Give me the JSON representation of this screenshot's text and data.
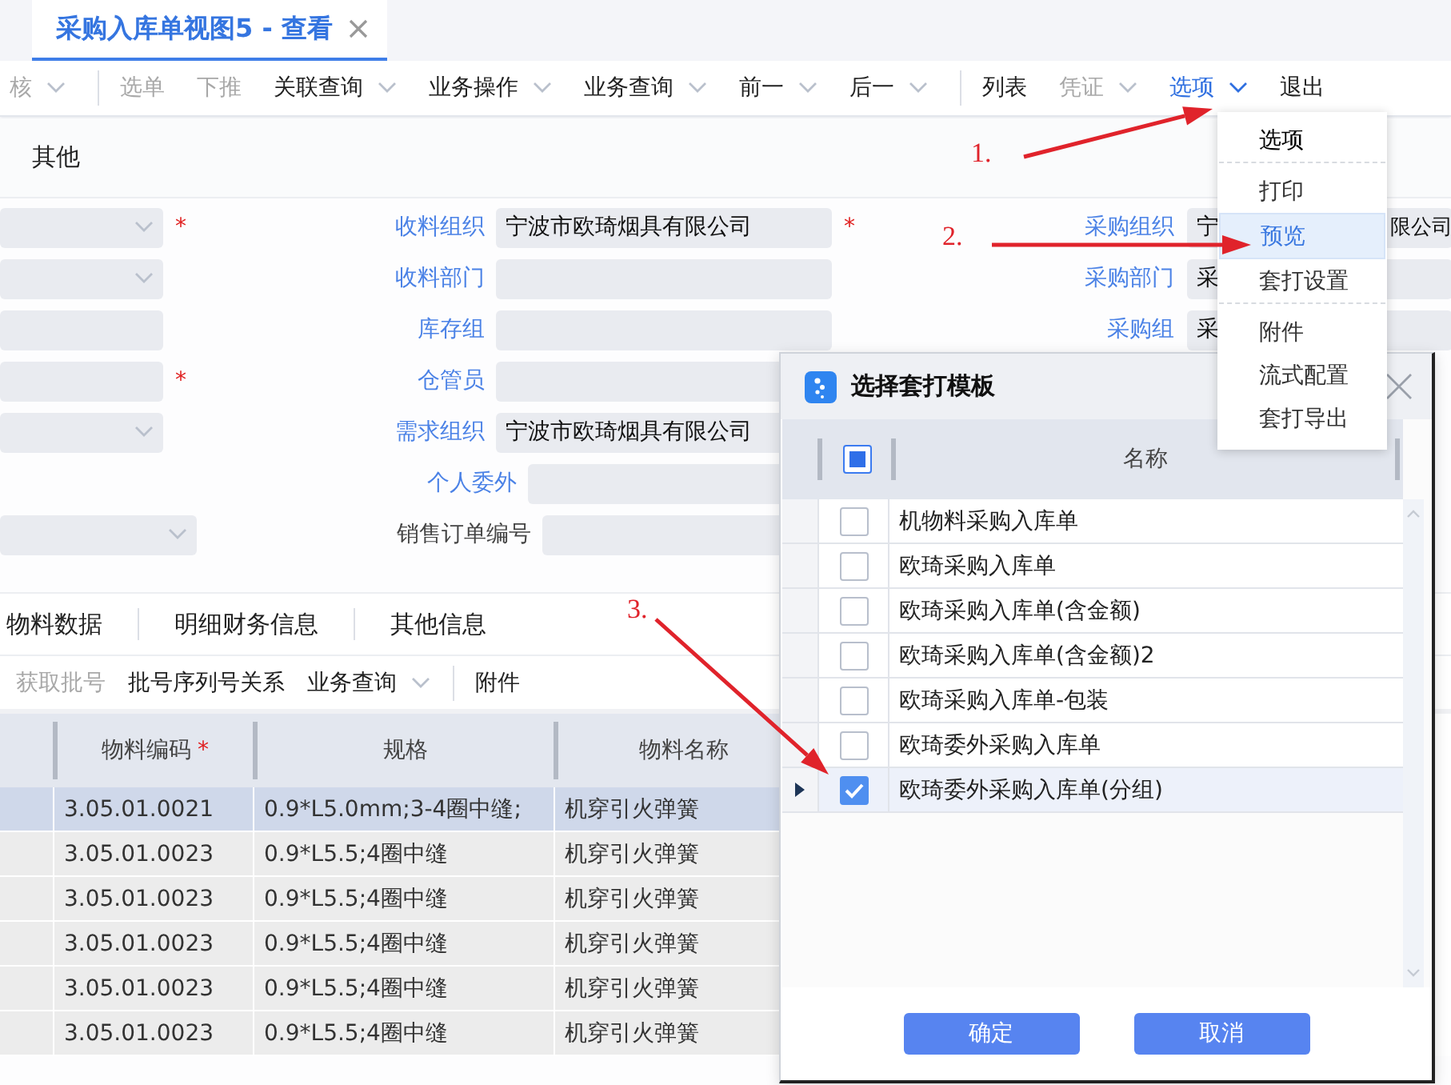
{
  "tab": {
    "title": "采购入库单视图5 - 查看",
    "selected": true
  },
  "toolbar": [
    {
      "label": "核",
      "disabled": true,
      "dropdown": true,
      "selected": false,
      "divider_before": false
    },
    {
      "label": "选单",
      "disabled": true,
      "dropdown": false,
      "selected": false,
      "divider_before": true
    },
    {
      "label": "下推",
      "disabled": true,
      "dropdown": false,
      "selected": false,
      "divider_before": false
    },
    {
      "label": "关联查询",
      "disabled": false,
      "dropdown": true,
      "selected": false,
      "divider_before": false
    },
    {
      "label": "业务操作",
      "disabled": false,
      "dropdown": true,
      "selected": false,
      "divider_before": false
    },
    {
      "label": "业务查询",
      "disabled": false,
      "dropdown": true,
      "selected": false,
      "divider_before": false
    },
    {
      "label": "前一",
      "disabled": false,
      "dropdown": true,
      "selected": false,
      "divider_before": false
    },
    {
      "label": "后一",
      "disabled": false,
      "dropdown": true,
      "selected": false,
      "divider_before": false
    },
    {
      "label": "列表",
      "disabled": false,
      "dropdown": false,
      "selected": false,
      "divider_before": true
    },
    {
      "label": "凭证",
      "disabled": true,
      "dropdown": true,
      "selected": false,
      "divider_before": false
    },
    {
      "label": "选项",
      "disabled": false,
      "dropdown": true,
      "selected": true,
      "divider_before": false
    },
    {
      "label": "退出",
      "disabled": false,
      "dropdown": false,
      "selected": false,
      "divider_before": false
    }
  ],
  "section_tab": {
    "label": "其他"
  },
  "form": {
    "rows": [
      {
        "left": {
          "kind": "dropdown",
          "mark": "*"
        },
        "middle": {
          "label": "收料组织",
          "value": "宁波市欧琦烟具有限公司",
          "mark": "*",
          "link": true
        },
        "right": {
          "label": "采购组织",
          "value": "宁",
          "value_end": "限公司"
        }
      },
      {
        "left": {
          "kind": "dropdown"
        },
        "middle": {
          "label": "收料部门",
          "link": true
        },
        "right": {
          "label": "采购部门",
          "value": "采"
        }
      },
      {
        "left": {
          "kind": "text"
        },
        "middle": {
          "label": "库存组",
          "link": true
        },
        "right": {
          "label": "采购组",
          "value": "采"
        }
      },
      {
        "left": {
          "kind": "text",
          "mark": "*"
        },
        "middle": {
          "label": "仓管员",
          "link": true
        }
      },
      {
        "left": {
          "kind": "dropdown"
        },
        "middle": {
          "label": "需求组织",
          "value": "宁波市欧琦烟具有限公司",
          "link": true
        }
      },
      {
        "middle": {
          "label": "个人委外",
          "link": true
        }
      },
      {
        "left": {
          "kind": "dropdown"
        },
        "middle": {
          "label": "销售订单编号",
          "link": false
        }
      }
    ]
  },
  "detail_tabs": [
    {
      "label": "物料数据"
    },
    {
      "label": "明细财务信息"
    },
    {
      "label": "其他信息"
    }
  ],
  "detail_toolbar": [
    {
      "label": "获取批号",
      "disabled": true,
      "dropdown": false,
      "divider_before": false
    },
    {
      "label": "批号序列号关系",
      "disabled": false,
      "dropdown": false,
      "divider_before": false
    },
    {
      "label": "业务查询",
      "disabled": false,
      "dropdown": true,
      "divider_before": false
    },
    {
      "label": "附件",
      "disabled": false,
      "dropdown": false,
      "divider_before": true
    }
  ],
  "table": {
    "columns": [
      {
        "label": "物料编码",
        "mark": "*"
      },
      {
        "label": "规格"
      },
      {
        "label": "物料名称"
      }
    ],
    "rows": [
      {
        "selected": true,
        "cells": [
          "3.05.01.0021",
          "0.9*L5.0mm;3-4圈中缝;",
          "机穿引火弹簧"
        ]
      },
      {
        "selected": false,
        "cells": [
          "3.05.01.0023",
          "0.9*L5.5;4圈中缝",
          "机穿引火弹簧"
        ]
      },
      {
        "selected": false,
        "cells": [
          "3.05.01.0023",
          "0.9*L5.5;4圈中缝",
          "机穿引火弹簧"
        ]
      },
      {
        "selected": false,
        "cells": [
          "3.05.01.0023",
          "0.9*L5.5;4圈中缝",
          "机穿引火弹簧"
        ]
      },
      {
        "selected": false,
        "cells": [
          "3.05.01.0023",
          "0.9*L5.5;4圈中缝",
          "机穿引火弹簧"
        ]
      },
      {
        "selected": false,
        "cells": [
          "3.05.01.0023",
          "0.9*L5.5;4圈中缝",
          "机穿引火弹簧"
        ]
      }
    ]
  },
  "dialog": {
    "title": "选择套打模板",
    "column": "名称",
    "select_all": {
      "checked": true
    },
    "rows": [
      {
        "name": "机物料采购入库单",
        "checked": false,
        "selected": false
      },
      {
        "name": "欧琦采购入库单",
        "checked": false,
        "selected": false
      },
      {
        "name": "欧琦采购入库单(含金额)",
        "checked": false,
        "selected": false
      },
      {
        "name": "欧琦采购入库单(含金额)2",
        "checked": false,
        "selected": false
      },
      {
        "name": "欧琦采购入库单-包装",
        "checked": false,
        "selected": false
      },
      {
        "name": "欧琦委外采购入库单",
        "checked": false,
        "selected": false
      },
      {
        "name": "欧琦委外采购入库单(分组)",
        "checked": true,
        "selected": true
      }
    ],
    "buttons": [
      "确定",
      "取消"
    ]
  },
  "menu": {
    "items": [
      {
        "label": "选项",
        "kind": "header",
        "selected": false,
        "divider_after": true
      },
      {
        "label": "打印",
        "kind": "item",
        "selected": false,
        "divider_after": false
      },
      {
        "label": "预览",
        "kind": "item",
        "selected": true,
        "divider_after": false
      },
      {
        "label": "套打设置",
        "kind": "item",
        "selected": false,
        "divider_after": true
      },
      {
        "label": "附件",
        "kind": "item",
        "selected": false,
        "divider_after": false
      },
      {
        "label": "流式配置",
        "kind": "item",
        "selected": false,
        "divider_after": false
      },
      {
        "label": "套打导出",
        "kind": "item",
        "selected": false,
        "divider_after": false
      }
    ]
  },
  "annotations": [
    {
      "label": "1."
    },
    {
      "label": "2."
    },
    {
      "label": "3."
    }
  ]
}
